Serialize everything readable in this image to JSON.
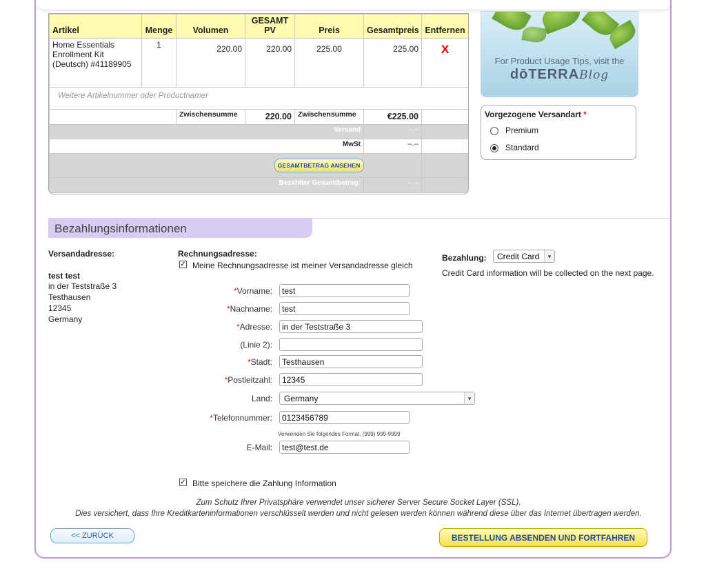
{
  "cart": {
    "headers": {
      "artikel": "Artikel",
      "menge": "Menge",
      "volumen": "Volumen",
      "gesamt_pv": "GESAMT PV",
      "preis": "Preis",
      "gesamtpreis": "Gesamtpreis",
      "entfernen": "Entfernen"
    },
    "item": {
      "name": "Home Essentials Enrollment Kit (Deutsch) #41189905",
      "qty": "1",
      "volume": "220.00",
      "total_pv": "220.00",
      "price": "225.00",
      "total_price": "225.00",
      "remove": "X"
    },
    "sku_placeholder": "Weitere Artikelnummer oder Productnamer",
    "subtotal_label_1": "Zwischensumme",
    "subtotal_pv": "220.00",
    "subtotal_label_2": "Zwischensumme",
    "subtotal_price": "€225.00",
    "shipping_label": "Versand",
    "shipping_value": "--.--",
    "tax_label": "MwSt",
    "tax_value": "--.--",
    "view_total_button": "GESAMTBETRAG ANSEHEN",
    "paid_total_label": "Bezahlter Gesamtbetrag:",
    "paid_total_value": "--.--"
  },
  "blog": {
    "line1": "For Product Usage Tips, visit the",
    "brand": "dōTERRA",
    "suffix": "Blog"
  },
  "shipping_method": {
    "title": "Vorgezogene Versandart",
    "required": "*",
    "options": [
      {
        "label": "Premium",
        "selected": false
      },
      {
        "label": "Standard",
        "selected": true
      }
    ]
  },
  "payment_section": {
    "title": "Bezahlungsinformationen"
  },
  "shipping_address": {
    "label": "Versandadresse:",
    "name": "test test",
    "street": "in der Teststraße 3",
    "city": "Testhausen",
    "zip": "12345",
    "country": "Germany"
  },
  "billing": {
    "label": "Rechnungsadresse:",
    "same_as_shipping": "Meine Rechnungsadresse ist meiner Versandadresse gleich",
    "fields": {
      "vorname": {
        "label": "Vorname:",
        "value": "test",
        "required": "*"
      },
      "nachname": {
        "label": "Nachname:",
        "value": "test",
        "required": "*"
      },
      "adresse": {
        "label": "Adresse:",
        "value": "in der Teststraße 3",
        "required": "*"
      },
      "linie2": {
        "label": "(Linie 2):",
        "value": ""
      },
      "stadt": {
        "label": "Stadt:",
        "value": "Testhausen",
        "required": "*"
      },
      "plz": {
        "label": "Postleitzahl:",
        "value": "12345",
        "required": "*"
      },
      "land": {
        "label": "Land:",
        "value": "Germany"
      },
      "telefon": {
        "label": "Telefonnummer:",
        "value": "0123456789",
        "required": "*"
      },
      "email": {
        "label": "E-Mail:",
        "value": "test@test.de"
      }
    },
    "phone_hint": "Verwenden Sie folgendes Format, (999) 999-9999"
  },
  "payment": {
    "label": "Bezahlung:",
    "method": "Credit Card",
    "note": "Credit Card information will be collected on the next page."
  },
  "save_payment": "Bitte speichere die Zahlung Information",
  "ssl_line1": "Zum Schutz Ihrer Privatsphäre verwendet unser sicherer Server Secure Socket Layer (SSL).",
  "ssl_line2": "Dies versichert, dass Ihre Kreditkarteninformationen verschlüsselt werden und nicht gelesen werden können während diese über das Internet übertragen werden.",
  "buttons": {
    "back": "<< ZURÜCK",
    "submit": "BESTELLUNG ABSENDEN UND FORTFAHREN"
  }
}
